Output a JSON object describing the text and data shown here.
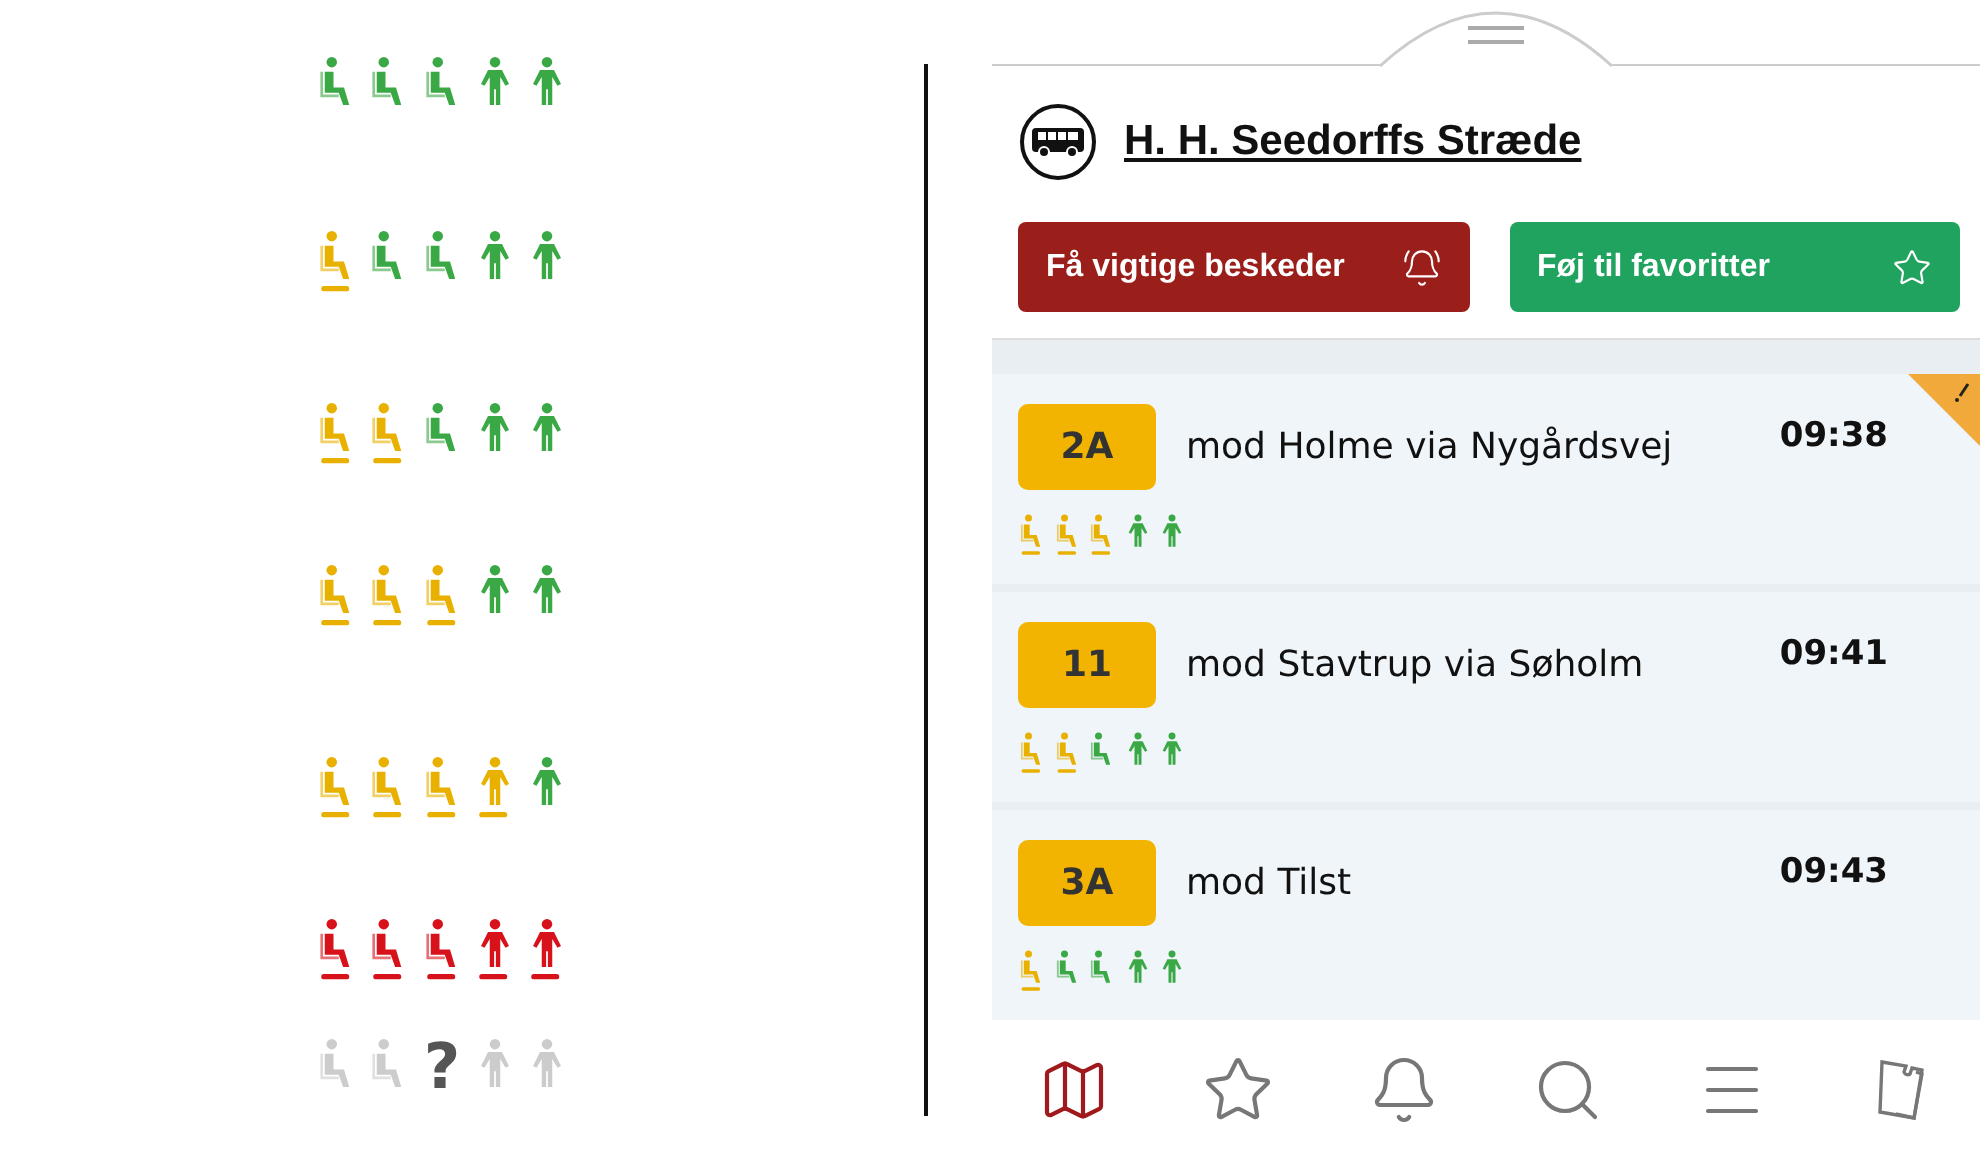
{
  "legend": [
    {
      "icons": [
        {
          "kind": "seat",
          "color": "#3aa845",
          "underlined": false
        },
        {
          "kind": "seat",
          "color": "#3aa845",
          "underlined": false
        },
        {
          "kind": "seat",
          "color": "#3aa845",
          "underlined": false
        },
        {
          "kind": "standing",
          "color": "#3aa845",
          "underlined": false
        },
        {
          "kind": "standing",
          "color": "#3aa845",
          "underlined": false
        }
      ]
    },
    {
      "icons": [
        {
          "kind": "seat",
          "color": "#e8b100",
          "underlined": true
        },
        {
          "kind": "seat",
          "color": "#3aa845",
          "underlined": false
        },
        {
          "kind": "seat",
          "color": "#3aa845",
          "underlined": false
        },
        {
          "kind": "standing",
          "color": "#3aa845",
          "underlined": false
        },
        {
          "kind": "standing",
          "color": "#3aa845",
          "underlined": false
        }
      ]
    },
    {
      "icons": [
        {
          "kind": "seat",
          "color": "#e8b100",
          "underlined": true
        },
        {
          "kind": "seat",
          "color": "#e8b100",
          "underlined": true
        },
        {
          "kind": "seat",
          "color": "#3aa845",
          "underlined": false
        },
        {
          "kind": "standing",
          "color": "#3aa845",
          "underlined": false
        },
        {
          "kind": "standing",
          "color": "#3aa845",
          "underlined": false
        }
      ]
    },
    {
      "icons": [
        {
          "kind": "seat",
          "color": "#e8b100",
          "underlined": true
        },
        {
          "kind": "seat",
          "color": "#e8b100",
          "underlined": true
        },
        {
          "kind": "seat",
          "color": "#e8b100",
          "underlined": true
        },
        {
          "kind": "standing",
          "color": "#3aa845",
          "underlined": false
        },
        {
          "kind": "standing",
          "color": "#3aa845",
          "underlined": false
        }
      ]
    },
    {
      "icons": [
        {
          "kind": "seat",
          "color": "#e8b100",
          "underlined": true
        },
        {
          "kind": "seat",
          "color": "#e8b100",
          "underlined": true
        },
        {
          "kind": "seat",
          "color": "#e8b100",
          "underlined": true
        },
        {
          "kind": "standing",
          "color": "#e8b100",
          "underlined": true
        },
        {
          "kind": "standing",
          "color": "#3aa845",
          "underlined": false
        }
      ]
    },
    {
      "icons": [
        {
          "kind": "seat",
          "color": "#d8121b",
          "underlined": true
        },
        {
          "kind": "seat",
          "color": "#d8121b",
          "underlined": true
        },
        {
          "kind": "seat",
          "color": "#d8121b",
          "underlined": true
        },
        {
          "kind": "standing",
          "color": "#d8121b",
          "underlined": true
        },
        {
          "kind": "standing",
          "color": "#d8121b",
          "underlined": true
        }
      ]
    },
    {
      "icons": [
        {
          "kind": "seat",
          "color": "#cccccc",
          "underlined": false
        },
        {
          "kind": "seat",
          "color": "#cccccc",
          "underlined": false
        },
        {
          "kind": "unknown",
          "label": "?",
          "color": "#555555"
        },
        {
          "kind": "standing",
          "color": "#cccccc",
          "underlined": false
        },
        {
          "kind": "standing",
          "color": "#cccccc",
          "underlined": false
        }
      ]
    }
  ],
  "stop": {
    "name": "H. H. Seedorffs Stræde"
  },
  "buttons": [
    {
      "label": "Få vigtige beskeder",
      "kind": "alerts"
    },
    {
      "label": "Føj til favoritter",
      "kind": "favorite"
    }
  ],
  "departures": [
    {
      "route": "2A",
      "destination": "mod Holme via Nygårdsvej",
      "time": "09:38",
      "alert": true,
      "icons": [
        {
          "kind": "seat",
          "color": "#e8b100",
          "underlined": true
        },
        {
          "kind": "seat",
          "color": "#e8b100",
          "underlined": true
        },
        {
          "kind": "seat",
          "color": "#e8b100",
          "underlined": true
        },
        {
          "kind": "standing",
          "color": "#3aa845",
          "underlined": false
        },
        {
          "kind": "standing",
          "color": "#3aa845",
          "underlined": false
        }
      ]
    },
    {
      "route": "11",
      "destination": "mod Stavtrup via Søholm",
      "time": "09:41",
      "alert": false,
      "icons": [
        {
          "kind": "seat",
          "color": "#e8b100",
          "underlined": true
        },
        {
          "kind": "seat",
          "color": "#e8b100",
          "underlined": true
        },
        {
          "kind": "seat",
          "color": "#3aa845",
          "underlined": false
        },
        {
          "kind": "standing",
          "color": "#3aa845",
          "underlined": false
        },
        {
          "kind": "standing",
          "color": "#3aa845",
          "underlined": false
        }
      ]
    },
    {
      "route": "3A",
      "destination": "mod Tilst",
      "time": "09:43",
      "alert": false,
      "icons": [
        {
          "kind": "seat",
          "color": "#e8b100",
          "underlined": true
        },
        {
          "kind": "seat",
          "color": "#3aa845",
          "underlined": false
        },
        {
          "kind": "seat",
          "color": "#3aa845",
          "underlined": false
        },
        {
          "kind": "standing",
          "color": "#3aa845",
          "underlined": false
        },
        {
          "kind": "standing",
          "color": "#3aa845",
          "underlined": false
        }
      ]
    }
  ],
  "nav": [
    {
      "kind": "map",
      "selected": true
    },
    {
      "kind": "favorites",
      "selected": false
    },
    {
      "kind": "alerts",
      "selected": false
    },
    {
      "kind": "search",
      "selected": false
    },
    {
      "kind": "menu",
      "selected": false
    },
    {
      "kind": "tickets",
      "selected": false
    }
  ]
}
